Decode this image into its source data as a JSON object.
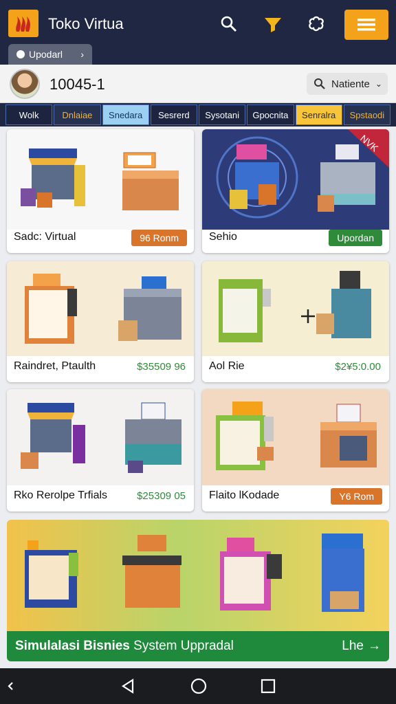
{
  "app": {
    "title": "Toko Virtua",
    "colors": {
      "topbar": "#1f2743",
      "accent": "#f3a21a",
      "price": "#2f8a3a"
    }
  },
  "toolbar": {
    "icons": [
      "search-icon",
      "filter-icon",
      "settings-icon",
      "menu-icon"
    ]
  },
  "chip": {
    "label": "Upodarl"
  },
  "profile": {
    "user_id": "10045-1",
    "sort_label": "Natiente"
  },
  "categories": [
    {
      "label": "Wolk"
    },
    {
      "label": "Dnlaiae"
    },
    {
      "label": "Snedara"
    },
    {
      "label": "Sesrerd"
    },
    {
      "label": "Sysotani"
    },
    {
      "label": "Gpocnita"
    },
    {
      "label": "Senralra"
    },
    {
      "label": "Spstaodi"
    }
  ],
  "cards": [
    {
      "title": "Sadc: Virtual",
      "badge": "96 Ronm",
      "badge_color": "#d9752a"
    },
    {
      "title": "Sehio",
      "badge": "Upordan",
      "badge_color": "#2f8a3a",
      "ribbon": "NVK"
    },
    {
      "title": "Raindret, Ptaulth",
      "price": "$35509 96"
    },
    {
      "title": "Aol Rie",
      "price": "$2¥5:0.00"
    },
    {
      "title": "Rko Rerolpe Trfials",
      "price": "$25309 05"
    },
    {
      "title": "Flaito lKodade",
      "badge": "Y6 Rom",
      "badge_color": "#d9752a"
    }
  ],
  "banner": {
    "title_bold": "Simulalasi Bisnies",
    "title_rest": "System Uppradal",
    "link": "Lhe"
  },
  "navbar": {
    "icons": [
      "back-icon",
      "home-icon",
      "recents-icon"
    ]
  }
}
